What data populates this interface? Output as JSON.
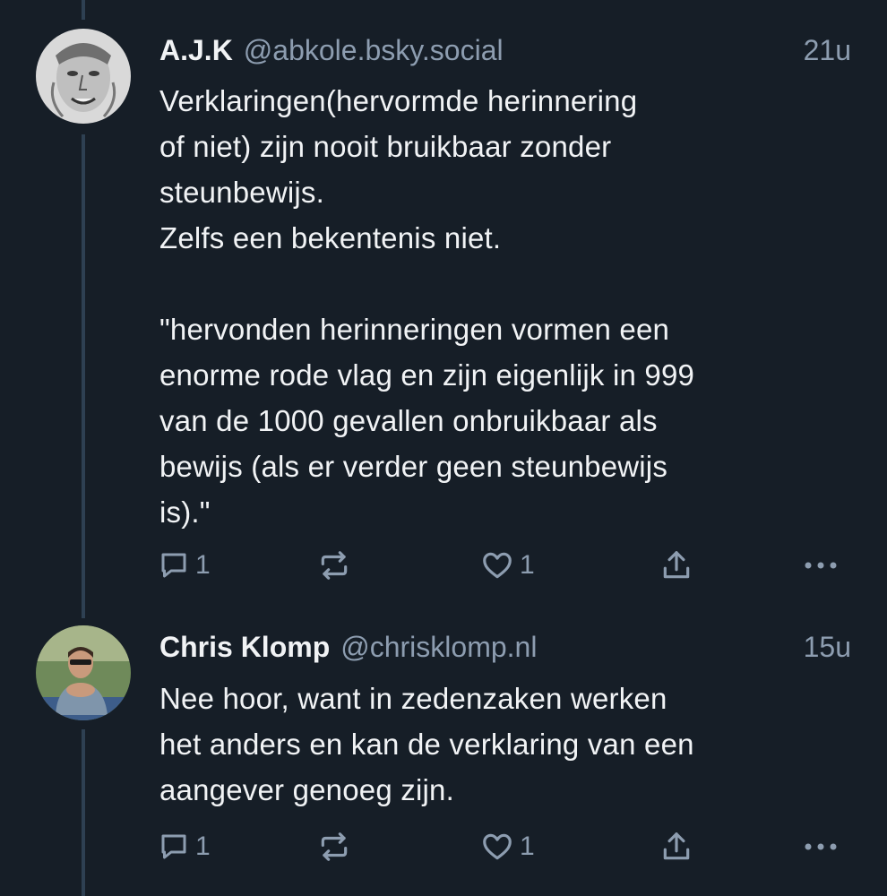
{
  "colors": {
    "background": "#161e27",
    "text": "#f1f3f5",
    "muted": "#8d9db0",
    "thread_line": "#2e4052"
  },
  "posts": [
    {
      "display_name": "A.J.K",
      "handle": "@abkole.bsky.social",
      "time": "21u",
      "text": "Verklaringen(hervormde herinnering\nof niet) zijn nooit bruikbaar zonder\nsteunbewijs.\nZelfs een bekentenis niet.\n\n\"hervonden herinneringen vormen een\nenorme rode vlag en zijn eigenlijk in 999\nvan de 1000 gevallen onbruikbaar als\nbewijs (als er verder geen steunbewijs\nis).\"",
      "reply_count": "1",
      "like_count": "1",
      "icons": [
        "reply-icon",
        "repost-icon",
        "like-icon",
        "share-icon",
        "more-icon"
      ]
    },
    {
      "display_name": "Chris Klomp",
      "handle": "@chrisklomp.nl",
      "time": "15u",
      "text": "Nee hoor, want in zedenzaken werken\nhet anders en kan de verklaring van een\naangever genoeg zijn.",
      "reply_count": "1",
      "like_count": "1",
      "icons": [
        "reply-icon",
        "repost-icon",
        "like-icon",
        "share-icon",
        "more-icon"
      ]
    }
  ]
}
